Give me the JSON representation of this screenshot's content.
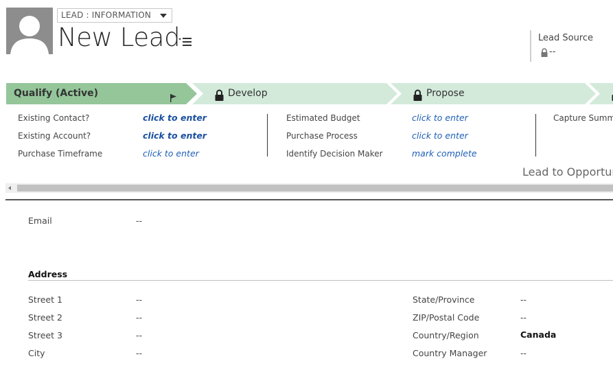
{
  "header": {
    "form_selector": "LEAD : INFORMATION",
    "title": "New Lead",
    "field_label": "Lead Source",
    "field_value": "--"
  },
  "process": {
    "stages": [
      {
        "label": "Qualify (Active)",
        "locked": false
      },
      {
        "label": "Develop",
        "locked": true
      },
      {
        "label": "Propose",
        "locked": true
      }
    ],
    "steps_col1": [
      {
        "label": "Existing Contact?",
        "value": "click to enter"
      },
      {
        "label": "Existing Account?",
        "value": "click to enter"
      },
      {
        "label": "Purchase Timeframe",
        "value": "click to enter"
      }
    ],
    "steps_col2": [
      {
        "label": "Estimated Budget",
        "value": "click to enter"
      },
      {
        "label": "Purchase Process",
        "value": "click to enter"
      },
      {
        "label": "Identify Decision Maker",
        "value": "mark complete"
      }
    ],
    "steps_col3": [
      {
        "label": "Capture Summa"
      }
    ],
    "process_name": "Lead to Opportur"
  },
  "form": {
    "email": {
      "label": "Email",
      "value": "--"
    },
    "address_section": "Address",
    "left_fields": [
      {
        "label": "Street 1",
        "value": "--"
      },
      {
        "label": "Street 2",
        "value": "--"
      },
      {
        "label": "Street 3",
        "value": "--"
      },
      {
        "label": "City",
        "value": "--"
      }
    ],
    "right_fields": [
      {
        "label": "State/Province",
        "value": "--"
      },
      {
        "label": "ZIP/Postal Code",
        "value": "--"
      },
      {
        "label": "Country/Region",
        "value": "Canada"
      },
      {
        "label": "Country Manager",
        "value": "--"
      }
    ]
  },
  "colors": {
    "active_stage": "#94c69a",
    "inactive_stage": "#d3eadb",
    "link": "#1e5fb5"
  }
}
